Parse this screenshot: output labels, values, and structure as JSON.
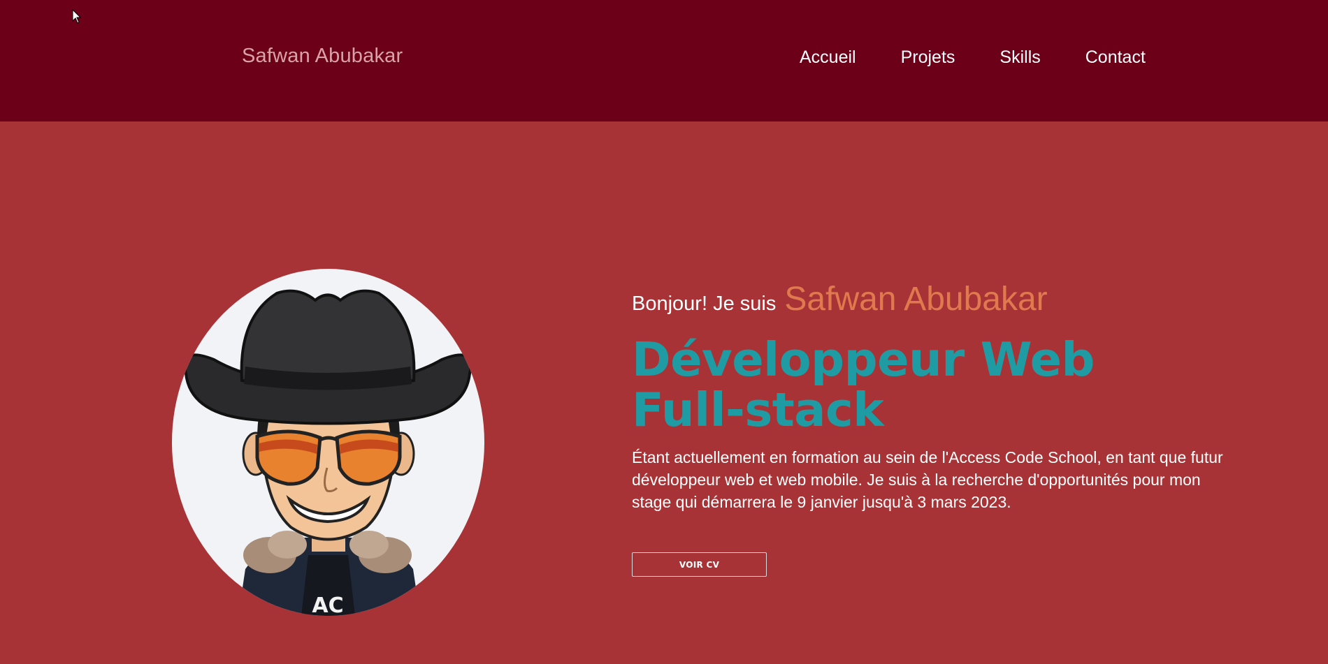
{
  "nav": {
    "brand": "Safwan Abubakar",
    "links": [
      {
        "label": "Accueil"
      },
      {
        "label": "Projets"
      },
      {
        "label": "Skills"
      },
      {
        "label": "Contact"
      }
    ]
  },
  "hero": {
    "greeting": "Bonjour! Je suis",
    "name": "Safwan Abubakar",
    "title_line1": "Développeur Web",
    "title_line2": "Full-stack",
    "description": "Étant actuellement en formation au sein de l'Access Code School, en tant que futur développeur web et web mobile. Je suis à la recherche d'opportunités pour mon stage qui démarrera le 9 janvier jusqu'à 3 mars 2023.",
    "cv_button": "VOIR CV",
    "avatar_shirt_text": "AC"
  },
  "colors": {
    "navbar_bg": "#6d0019",
    "page_bg": "#a83336",
    "accent_name": "#e07a4e",
    "accent_title": "#1f9ca3"
  },
  "icons": {
    "cursor": "mouse-pointer-icon",
    "avatar": "cowboy-avatar-illustration"
  }
}
